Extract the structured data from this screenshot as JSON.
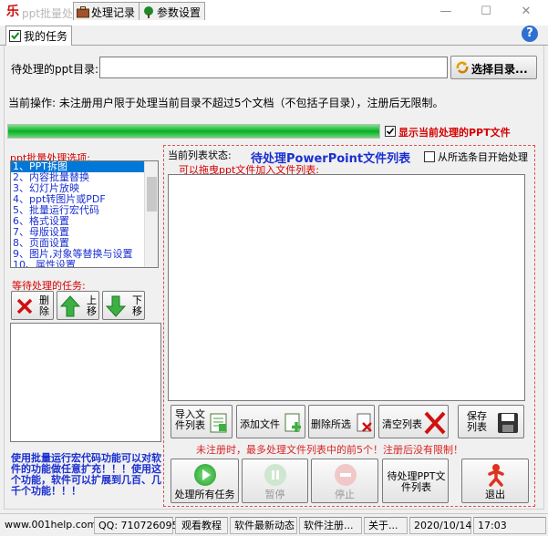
{
  "window": {
    "title": "ppt批量处理大师",
    "logo_glyph": "乐",
    "minimize_glyph": "—",
    "maximize_glyph": "☐",
    "close_glyph": "✕"
  },
  "tabs": [
    {
      "label": "我的任务",
      "icon": "checkbox-icon",
      "active": true
    },
    {
      "label": "处理记录",
      "icon": "briefcase-icon",
      "active": false
    },
    {
      "label": "参数设置",
      "icon": "tree-icon",
      "active": false
    }
  ],
  "help_glyph": "?",
  "directory": {
    "label": "待处理的ppt目录:",
    "value": "",
    "select_button": "选择目录..."
  },
  "current_operation": "当前操作: 未注册用户限于处理当前目录不超过5个文档（不包括子目录），注册后无限制。",
  "progress": {
    "value": 1.0,
    "color": "#06b025"
  },
  "show_current_file": {
    "label": "显示当前处理的PPT文件",
    "checked": true
  },
  "options": {
    "title": "ppt批量处理选项:",
    "items": [
      "1、PPT拆图",
      "2、内容批量替换",
      "3、幻灯片放映",
      "4、ppt转图片或PDF",
      "5、批量运行宏代码",
      "6、格式设置",
      "7、母版设置",
      "8、页面设置",
      "9、图片,对象等替换与设置",
      "10、属性设置"
    ],
    "selected_index": 0
  },
  "pending_tasks": {
    "title": "等待处理的任务:",
    "delete_label": "删除",
    "up_label": "上移",
    "down_label": "下移"
  },
  "macro_note": "使用批量运行宏代码功能可以对软件的功能做任意扩充！！！使用这个功能，软件可以扩展到几百、几千个功能！！！",
  "file_list": {
    "status_label": "当前列表状态:",
    "title": "待处理PowerPoint文件列表",
    "start_from_selected": {
      "label": "从所选条目开始处理",
      "checked": false
    },
    "drag_hint": "可以拖曳ppt文件加入文件列表:",
    "import_button": "导入文件列表",
    "add_file_button": "添加文件",
    "delete_selected_button": "删除所选",
    "clear_list_button": "清空列表",
    "save_list_button": "保存列表",
    "limit_note": "未注册时，最多处理文件列表中的前5个！注册后没有限制！"
  },
  "actions": {
    "process_all": "处理所有任务",
    "pause": "暂停",
    "stop": "停止",
    "pending_ppt_list": "待处理PPT文件列表",
    "exit": "退出"
  },
  "statusbar": {
    "website": "www.001help.com",
    "qq": "QQ: 710726095",
    "watch_tutorial": "观看教程",
    "latest_news": "软件最新动态",
    "register": "软件注册...",
    "about": "关于...",
    "date": "2020/10/14",
    "time": "17:03"
  },
  "colors": {
    "accent_red": "#d40000",
    "accent_blue": "#1a2fd0",
    "progress_green": "#06b025"
  }
}
